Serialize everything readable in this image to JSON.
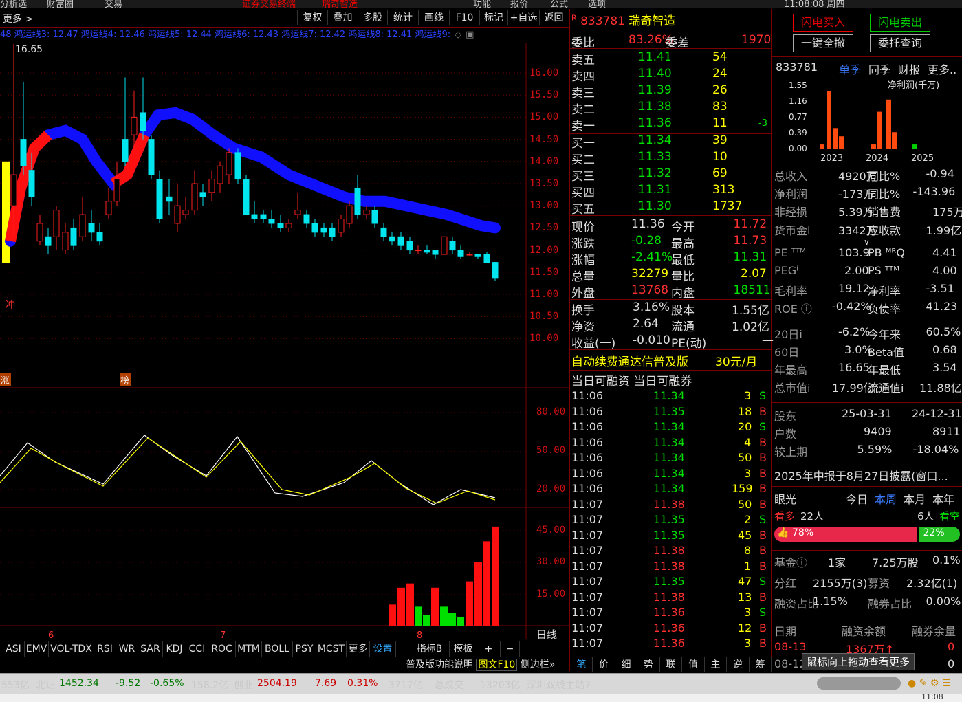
{
  "top_menu": [
    "功能",
    "报价",
    "公式",
    "选项",
    "11:08:08 周四"
  ],
  "top_left": [
    "分析选",
    "财富圈",
    "交易"
  ],
  "top_center": "证券交易终端",
  "top_center2": "瑞奇智造",
  "toolbar": {
    "more": "更多 >",
    "buttons": [
      "复权",
      "叠加",
      "多股",
      "统计",
      "画线",
      "F10",
      "标记",
      "+自选",
      "返回"
    ]
  },
  "ma_line": "48 鸿运线3: 12.47 鸿运线4: 12.46 鸿运线5: 12.44 鸿运线6: 12.43 鸿运线7: 12.42 鸿运线8: 12.41 鸿运线9:",
  "chart_labels": {
    "high_mark": "16.65",
    "chong": "冲",
    "zhang": "涨",
    "bang": "榜",
    "month6": "6",
    "month7": "7",
    "month8": "8",
    "period": "日线"
  },
  "chart_data": [
    {
      "type": "candlestick",
      "yticks": [
        "16.00",
        "15.50",
        "15.00",
        "14.50",
        "14.00",
        "13.50",
        "13.00",
        "12.50",
        "12.00",
        "11.50",
        "11.00",
        "10.50",
        "10.00"
      ],
      "high": "16.65",
      "latest_close": "11.36",
      "up_color": "#ff2020",
      "down_color": "#00e5ee",
      "ma_band_color": "#1010ff"
    },
    {
      "type": "line",
      "name": "KDJ",
      "yticks": [
        "80.00",
        "50.00",
        "20.00"
      ],
      "series_colors": [
        "#ffffff",
        "#ffff00"
      ]
    },
    {
      "type": "bar",
      "yticks": [
        "45.00",
        "30.00",
        "15.00"
      ],
      "values": [
        10,
        18,
        20,
        9,
        5,
        18,
        9,
        6,
        4,
        21,
        30,
        40,
        47
      ],
      "colors": [
        "red",
        "red",
        "red",
        "green",
        "green",
        "red",
        "green",
        "green",
        "green",
        "red",
        "red",
        "red",
        "red"
      ]
    }
  ],
  "indicator_tabs": [
    "ASI",
    "EMV",
    "VOL-TDX",
    "RSI",
    "WR",
    "SAR",
    "KDJ",
    "CCI",
    "ROC",
    "MTM",
    "BOLL",
    "PSY",
    "MCST",
    "更多",
    "设置",
    "指标B",
    "模板",
    "+",
    "−"
  ],
  "bottom_links": [
    "普及版功能说明",
    "图文F10",
    "侧边栏»"
  ],
  "quote": {
    "header_r": "R",
    "code": "833781",
    "name": "瑞奇智造",
    "weibi_label": "委比",
    "weibi": "83.26%",
    "weicha_label": "委差",
    "weicha": "1970",
    "asks": [
      {
        "l": "卖五",
        "p": "11.41",
        "v": "54"
      },
      {
        "l": "卖四",
        "p": "11.40",
        "v": "24"
      },
      {
        "l": "卖三",
        "p": "11.39",
        "v": "26"
      },
      {
        "l": "卖二",
        "p": "11.38",
        "v": "83"
      },
      {
        "l": "卖一",
        "p": "11.36",
        "v": "11",
        "d": "-3"
      }
    ],
    "bids": [
      {
        "l": "买一",
        "p": "11.34",
        "v": "39"
      },
      {
        "l": "买二",
        "p": "11.33",
        "v": "10"
      },
      {
        "l": "买三",
        "p": "11.32",
        "v": "69"
      },
      {
        "l": "买四",
        "p": "11.31",
        "v": "313"
      },
      {
        "l": "买五",
        "p": "11.30",
        "v": "1737"
      }
    ],
    "stats": [
      {
        "l1": "现价",
        "v1": "11.36",
        "l2": "今开",
        "v2": "11.72"
      },
      {
        "l1": "涨跌",
        "v1": "-0.28",
        "l2": "最高",
        "v2": "11.73"
      },
      {
        "l1": "涨幅",
        "v1": "-2.41%",
        "l2": "最低",
        "v2": "11.31"
      },
      {
        "l1": "总量",
        "v1": "32279",
        "l2": "量比",
        "v2": "2.07"
      },
      {
        "l1": "外盘",
        "v1": "13768",
        "l2": "内盘",
        "v2": "18511"
      }
    ],
    "stats2": [
      {
        "l1": "换手",
        "v1": "3.16%",
        "l2": "股本",
        "v2": "1.55亿"
      },
      {
        "l1": "净资",
        "v1": "2.64",
        "l2": "流通",
        "v2": "1.02亿"
      },
      {
        "l1": "收益(一)",
        "v1": "-0.010",
        "l2": "PE(动)",
        "v2": "—"
      }
    ],
    "ad": "自动续费通达信普及版",
    "ad_price": "30元/月",
    "margin_line": "当日可融资 当日可融券"
  },
  "ticks": [
    [
      "11:06",
      "11.34",
      "3",
      "S"
    ],
    [
      "11:06",
      "11.35",
      "18",
      "B"
    ],
    [
      "11:06",
      "11.34",
      "20",
      "S"
    ],
    [
      "11:06",
      "11.34",
      "4",
      "B"
    ],
    [
      "11:06",
      "11.34",
      "50",
      "B"
    ],
    [
      "11:06",
      "11.34",
      "3",
      "B"
    ],
    [
      "11:06",
      "11.34",
      "159",
      "B"
    ],
    [
      "11:07",
      "11.38",
      "50",
      "B"
    ],
    [
      "11:07",
      "11.35",
      "2",
      "S"
    ],
    [
      "11:07",
      "11.35",
      "45",
      "B"
    ],
    [
      "11:07",
      "11.38",
      "8",
      "B"
    ],
    [
      "11:07",
      "11.38",
      "1",
      "B"
    ],
    [
      "11:07",
      "11.35",
      "47",
      "S"
    ],
    [
      "11:07",
      "11.38",
      "13",
      "B"
    ],
    [
      "11:07",
      "11.36",
      "3",
      "S"
    ],
    [
      "11:07",
      "11.36",
      "12",
      "B"
    ],
    [
      "11:07",
      "11.36",
      "3",
      "B"
    ]
  ],
  "tick_tabs": [
    "笔",
    "价",
    "细",
    "势",
    "联",
    "值",
    "主",
    "逆",
    "筹"
  ],
  "right": {
    "buy_flash": "闪电买入",
    "sell_flash": "闪电卖出",
    "clear_all": "一键全撤",
    "order_query": "委托查询",
    "code": "833781",
    "tabs": [
      "单季",
      "同季",
      "财报",
      "更多.."
    ],
    "profit_label": "净利润(千万)",
    "y_ticks": [
      "1.55",
      "1.16",
      "0.77",
      "0.39",
      "0.00"
    ],
    "years": [
      "2023",
      "2024",
      "2025"
    ],
    "bars": [
      0.1,
      1.4,
      0.5,
      0.3,
      0.1,
      0.9,
      1.2,
      0.4,
      0.1
    ],
    "fin": [
      {
        "a": "总收入",
        "b": "4920万",
        "c": "同比%",
        "d": "-0.94"
      },
      {
        "a": "净利润",
        "b": "-173万",
        "c": "同比%",
        "d": "-143.96"
      },
      {
        "a": "非经损",
        "b": "5.39万",
        "c": "销售费",
        "d": "175万"
      },
      {
        "a": "货币金i",
        "b": "3342万",
        "c": "应收款",
        "d": "1.99亿"
      },
      {
        "a": "PE ᵀᵀᴹ",
        "b": "103.9",
        "c": "PB ᴹᴿQ",
        "d": "4.41"
      },
      {
        "a": "PEGⁱ",
        "b": "2.00",
        "c": "PS ᵀᵀᴹ",
        "d": "4.00"
      },
      {
        "a": "毛利率",
        "b": "19.12",
        "c": "净利率",
        "d": "-3.51"
      },
      {
        "a": "ROE ⓘ",
        "b": "-0.42%",
        "c": "负债率",
        "d": "41.23"
      },
      {
        "a": "20日i",
        "b": "-6.2%",
        "c": "今年来",
        "d": "60.5%"
      },
      {
        "a": "60日",
        "b": "3.0%",
        "c": "Beta值",
        "d": "0.68"
      },
      {
        "a": "年最高",
        "b": "16.65",
        "c": "年最低",
        "d": "3.54"
      },
      {
        "a": "总市值i",
        "b": "17.99亿",
        "c": "流通值i",
        "d": "11.88亿"
      }
    ],
    "share": {
      "label": "股东",
      "d1": "25-03-31",
      "d2": "24-12-31",
      "rows": [
        {
          "a": "户数",
          "b": "9409",
          "c": "8911"
        },
        {
          "a": "较上期",
          "b": "5.59%",
          "c": "-18.04%"
        }
      ]
    },
    "report": "2025年中报于8月27日披露(窗口...",
    "eye": {
      "label": "眼光",
      "tabs": [
        "今日",
        "本周",
        "本月",
        "本年"
      ],
      "bull": "看多",
      "bull_n": "22人",
      "bear_n": "6人",
      "bear": "看空",
      "bull_pct": "78%",
      "bear_pct": "22%"
    },
    "fund": {
      "a": "基金ⓘ",
      "b": "1家",
      "c": "7.25万股",
      "d": "0.1%"
    },
    "div": {
      "a": "分红",
      "b": "2155万(3)",
      "c": "募资",
      "d": "2.32亿(1)"
    },
    "margin": {
      "a": "融资占比",
      "b": "1.15%",
      "c": "融券占比",
      "d": "0.00%"
    },
    "mtable": {
      "h1": "日期",
      "h2": "融资余额",
      "h3": "融券余量",
      "r1a": "08-13",
      "r1b": "1367万↑",
      "r1c": "0",
      "r2a": "08-12",
      "r2c": "0"
    },
    "tooltip": "鼠标向上拖动查看更多"
  },
  "status": {
    "s1": "553亿",
    "s2": "北证",
    "s3": "1452.34",
    "s4": "-9.52",
    "s5": "-0.65%",
    "s6": "158.2亿",
    "s7": "创业",
    "s8": "2504.19",
    "s9": "7.69",
    "s10": "0.31%",
    "s11": "3717亿",
    "s12": "总成交",
    "s13": "13203亿",
    "s14": "深圳双线主站7",
    "time": "11:08"
  }
}
